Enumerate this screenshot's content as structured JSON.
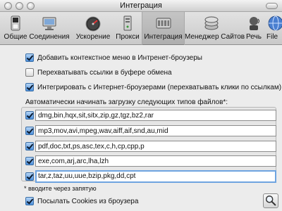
{
  "window": {
    "title": "Интеграция"
  },
  "toolbar": {
    "items": [
      {
        "label": "Общие",
        "icon": "switch-icon"
      },
      {
        "label": "Соединения",
        "icon": "connection-icon"
      },
      {
        "label": "Ускорение",
        "icon": "speedometer-icon"
      },
      {
        "label": "Прокси",
        "icon": "proxy-icon"
      },
      {
        "label": "Интеграция",
        "icon": "integration-icon"
      },
      {
        "label": "Менеджер Сайтов",
        "icon": "site-manager-icon"
      },
      {
        "label": "Речь",
        "icon": "speech-icon"
      },
      {
        "label": "File",
        "icon": "file-icon"
      }
    ],
    "selected": "Интеграция"
  },
  "options": {
    "context_menu": {
      "label": "Добавить контекстное меню в Интренет-броузеры",
      "checked": true
    },
    "clipboard": {
      "label": "Перехватывать ссылки в буфере обмена",
      "checked": false
    },
    "integrate": {
      "label": "Интегрировать с Интернет-броузерами (перехватывать клики по ссылкам)",
      "checked": true
    }
  },
  "filetypes": {
    "header": "Автоматически начинать загрузку следующих типов файлов*:",
    "rows": [
      {
        "value": "dmg,bin,hqx,sit,sitx,zip,gz,tgz,bz2,rar",
        "checked": true
      },
      {
        "value": "mp3,mov,avi,mpeg,wav,aiff,aif,snd,au,mid",
        "checked": true
      },
      {
        "value": "pdf,doc,txt,ps,asc,tex,c,h,cp,cpp,p",
        "checked": true
      },
      {
        "value": "exe,com,arj,arc,lha,lzh",
        "checked": true
      },
      {
        "value": "tar,z,taz,uu,uue,bzip,pkg,dd,cpt",
        "checked": true
      }
    ],
    "footnote": "*  вводите через запятую"
  },
  "cookies": {
    "label": "Посылать Cookies из броузера",
    "checked": true
  },
  "colors": {
    "accent": "#4b8fdc",
    "focus_ring": "#6ea4e0"
  }
}
